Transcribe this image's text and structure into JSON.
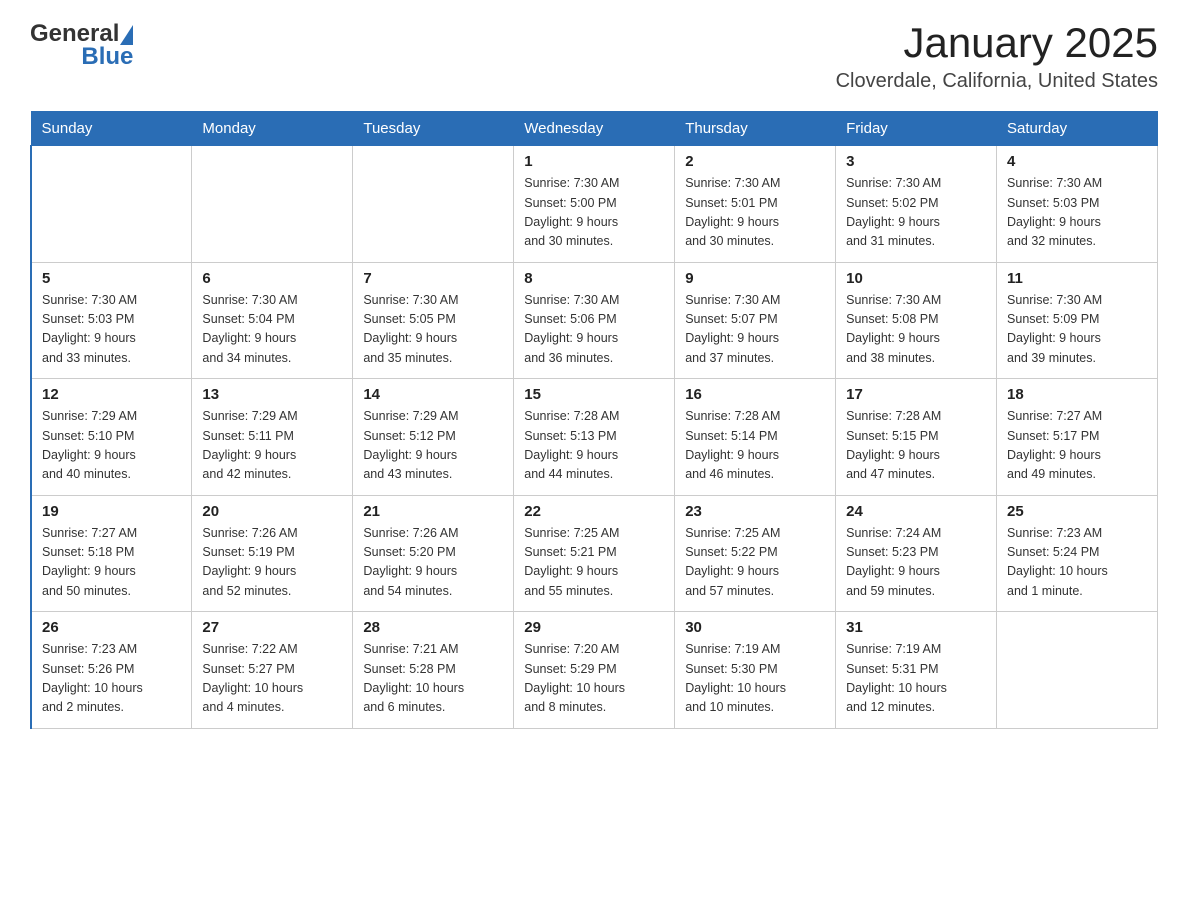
{
  "header": {
    "logo_general": "General",
    "logo_blue": "Blue",
    "title": "January 2025",
    "subtitle": "Cloverdale, California, United States"
  },
  "days_of_week": [
    "Sunday",
    "Monday",
    "Tuesday",
    "Wednesday",
    "Thursday",
    "Friday",
    "Saturday"
  ],
  "weeks": [
    [
      {
        "day": "",
        "info": ""
      },
      {
        "day": "",
        "info": ""
      },
      {
        "day": "",
        "info": ""
      },
      {
        "day": "1",
        "info": "Sunrise: 7:30 AM\nSunset: 5:00 PM\nDaylight: 9 hours\nand 30 minutes."
      },
      {
        "day": "2",
        "info": "Sunrise: 7:30 AM\nSunset: 5:01 PM\nDaylight: 9 hours\nand 30 minutes."
      },
      {
        "day": "3",
        "info": "Sunrise: 7:30 AM\nSunset: 5:02 PM\nDaylight: 9 hours\nand 31 minutes."
      },
      {
        "day": "4",
        "info": "Sunrise: 7:30 AM\nSunset: 5:03 PM\nDaylight: 9 hours\nand 32 minutes."
      }
    ],
    [
      {
        "day": "5",
        "info": "Sunrise: 7:30 AM\nSunset: 5:03 PM\nDaylight: 9 hours\nand 33 minutes."
      },
      {
        "day": "6",
        "info": "Sunrise: 7:30 AM\nSunset: 5:04 PM\nDaylight: 9 hours\nand 34 minutes."
      },
      {
        "day": "7",
        "info": "Sunrise: 7:30 AM\nSunset: 5:05 PM\nDaylight: 9 hours\nand 35 minutes."
      },
      {
        "day": "8",
        "info": "Sunrise: 7:30 AM\nSunset: 5:06 PM\nDaylight: 9 hours\nand 36 minutes."
      },
      {
        "day": "9",
        "info": "Sunrise: 7:30 AM\nSunset: 5:07 PM\nDaylight: 9 hours\nand 37 minutes."
      },
      {
        "day": "10",
        "info": "Sunrise: 7:30 AM\nSunset: 5:08 PM\nDaylight: 9 hours\nand 38 minutes."
      },
      {
        "day": "11",
        "info": "Sunrise: 7:30 AM\nSunset: 5:09 PM\nDaylight: 9 hours\nand 39 minutes."
      }
    ],
    [
      {
        "day": "12",
        "info": "Sunrise: 7:29 AM\nSunset: 5:10 PM\nDaylight: 9 hours\nand 40 minutes."
      },
      {
        "day": "13",
        "info": "Sunrise: 7:29 AM\nSunset: 5:11 PM\nDaylight: 9 hours\nand 42 minutes."
      },
      {
        "day": "14",
        "info": "Sunrise: 7:29 AM\nSunset: 5:12 PM\nDaylight: 9 hours\nand 43 minutes."
      },
      {
        "day": "15",
        "info": "Sunrise: 7:28 AM\nSunset: 5:13 PM\nDaylight: 9 hours\nand 44 minutes."
      },
      {
        "day": "16",
        "info": "Sunrise: 7:28 AM\nSunset: 5:14 PM\nDaylight: 9 hours\nand 46 minutes."
      },
      {
        "day": "17",
        "info": "Sunrise: 7:28 AM\nSunset: 5:15 PM\nDaylight: 9 hours\nand 47 minutes."
      },
      {
        "day": "18",
        "info": "Sunrise: 7:27 AM\nSunset: 5:17 PM\nDaylight: 9 hours\nand 49 minutes."
      }
    ],
    [
      {
        "day": "19",
        "info": "Sunrise: 7:27 AM\nSunset: 5:18 PM\nDaylight: 9 hours\nand 50 minutes."
      },
      {
        "day": "20",
        "info": "Sunrise: 7:26 AM\nSunset: 5:19 PM\nDaylight: 9 hours\nand 52 minutes."
      },
      {
        "day": "21",
        "info": "Sunrise: 7:26 AM\nSunset: 5:20 PM\nDaylight: 9 hours\nand 54 minutes."
      },
      {
        "day": "22",
        "info": "Sunrise: 7:25 AM\nSunset: 5:21 PM\nDaylight: 9 hours\nand 55 minutes."
      },
      {
        "day": "23",
        "info": "Sunrise: 7:25 AM\nSunset: 5:22 PM\nDaylight: 9 hours\nand 57 minutes."
      },
      {
        "day": "24",
        "info": "Sunrise: 7:24 AM\nSunset: 5:23 PM\nDaylight: 9 hours\nand 59 minutes."
      },
      {
        "day": "25",
        "info": "Sunrise: 7:23 AM\nSunset: 5:24 PM\nDaylight: 10 hours\nand 1 minute."
      }
    ],
    [
      {
        "day": "26",
        "info": "Sunrise: 7:23 AM\nSunset: 5:26 PM\nDaylight: 10 hours\nand 2 minutes."
      },
      {
        "day": "27",
        "info": "Sunrise: 7:22 AM\nSunset: 5:27 PM\nDaylight: 10 hours\nand 4 minutes."
      },
      {
        "day": "28",
        "info": "Sunrise: 7:21 AM\nSunset: 5:28 PM\nDaylight: 10 hours\nand 6 minutes."
      },
      {
        "day": "29",
        "info": "Sunrise: 7:20 AM\nSunset: 5:29 PM\nDaylight: 10 hours\nand 8 minutes."
      },
      {
        "day": "30",
        "info": "Sunrise: 7:19 AM\nSunset: 5:30 PM\nDaylight: 10 hours\nand 10 minutes."
      },
      {
        "day": "31",
        "info": "Sunrise: 7:19 AM\nSunset: 5:31 PM\nDaylight: 10 hours\nand 12 minutes."
      },
      {
        "day": "",
        "info": ""
      }
    ]
  ]
}
